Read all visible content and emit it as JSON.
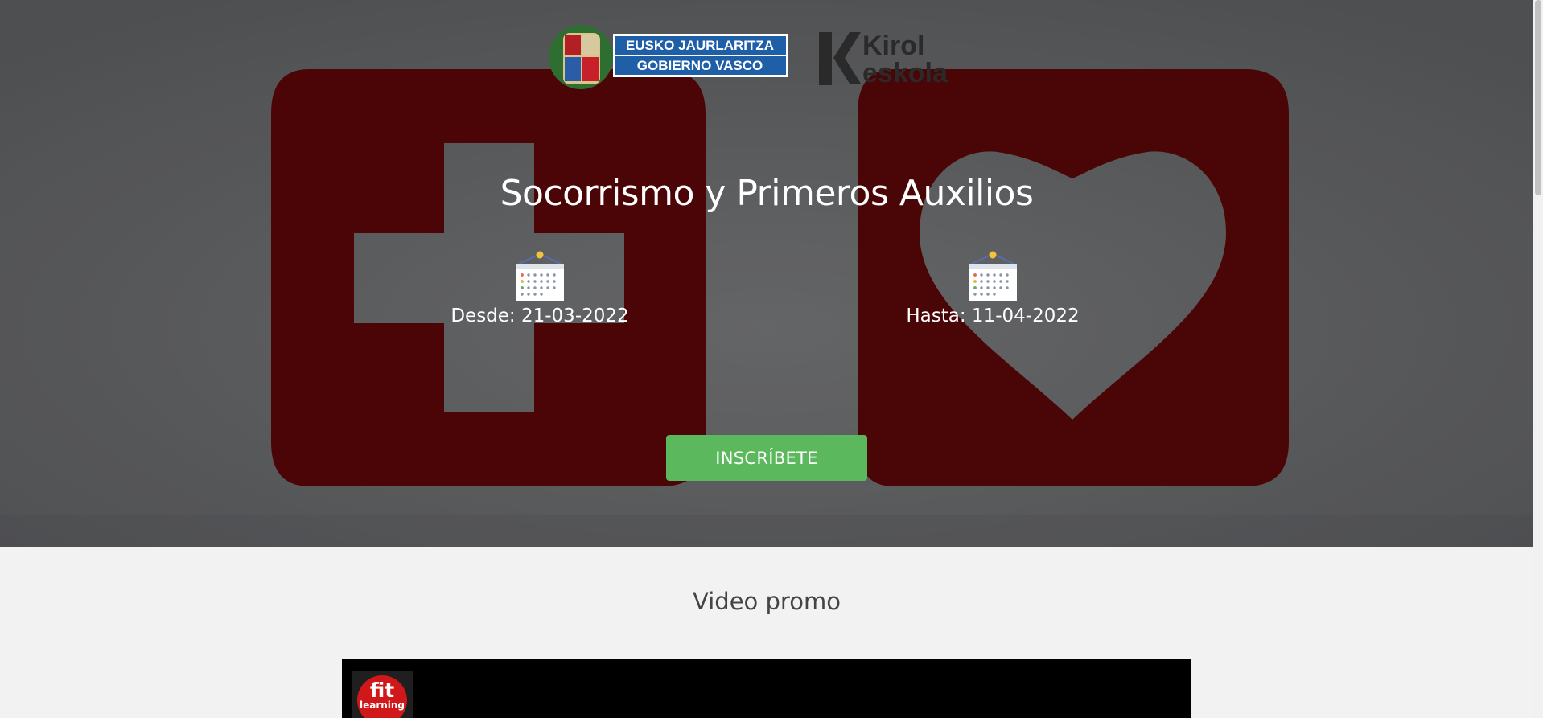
{
  "hero": {
    "title": "Socorrismo y Primeros Auxilios",
    "date_from": "Desde: 21-03-2022",
    "date_to": "Hasta: 11-04-2022",
    "cta_label": "INSCRÍBETE",
    "icons": {
      "calendar": "calendar-icon"
    }
  },
  "logos": {
    "government": {
      "line1": "EUSKO JAURLARITZA",
      "line2": "GOBIERNO VASCO"
    },
    "kirol": {
      "line1": "Kirol",
      "line2": "eskola"
    }
  },
  "video_section": {
    "title": "Video promo",
    "channel_avatar": {
      "line1": "fit",
      "line2": "learning"
    }
  },
  "colors": {
    "cta": "#5cb85c",
    "hero_background": "#5d5e60",
    "first_aid_red": "#4e0304",
    "page_background": "#f2f2f2"
  }
}
